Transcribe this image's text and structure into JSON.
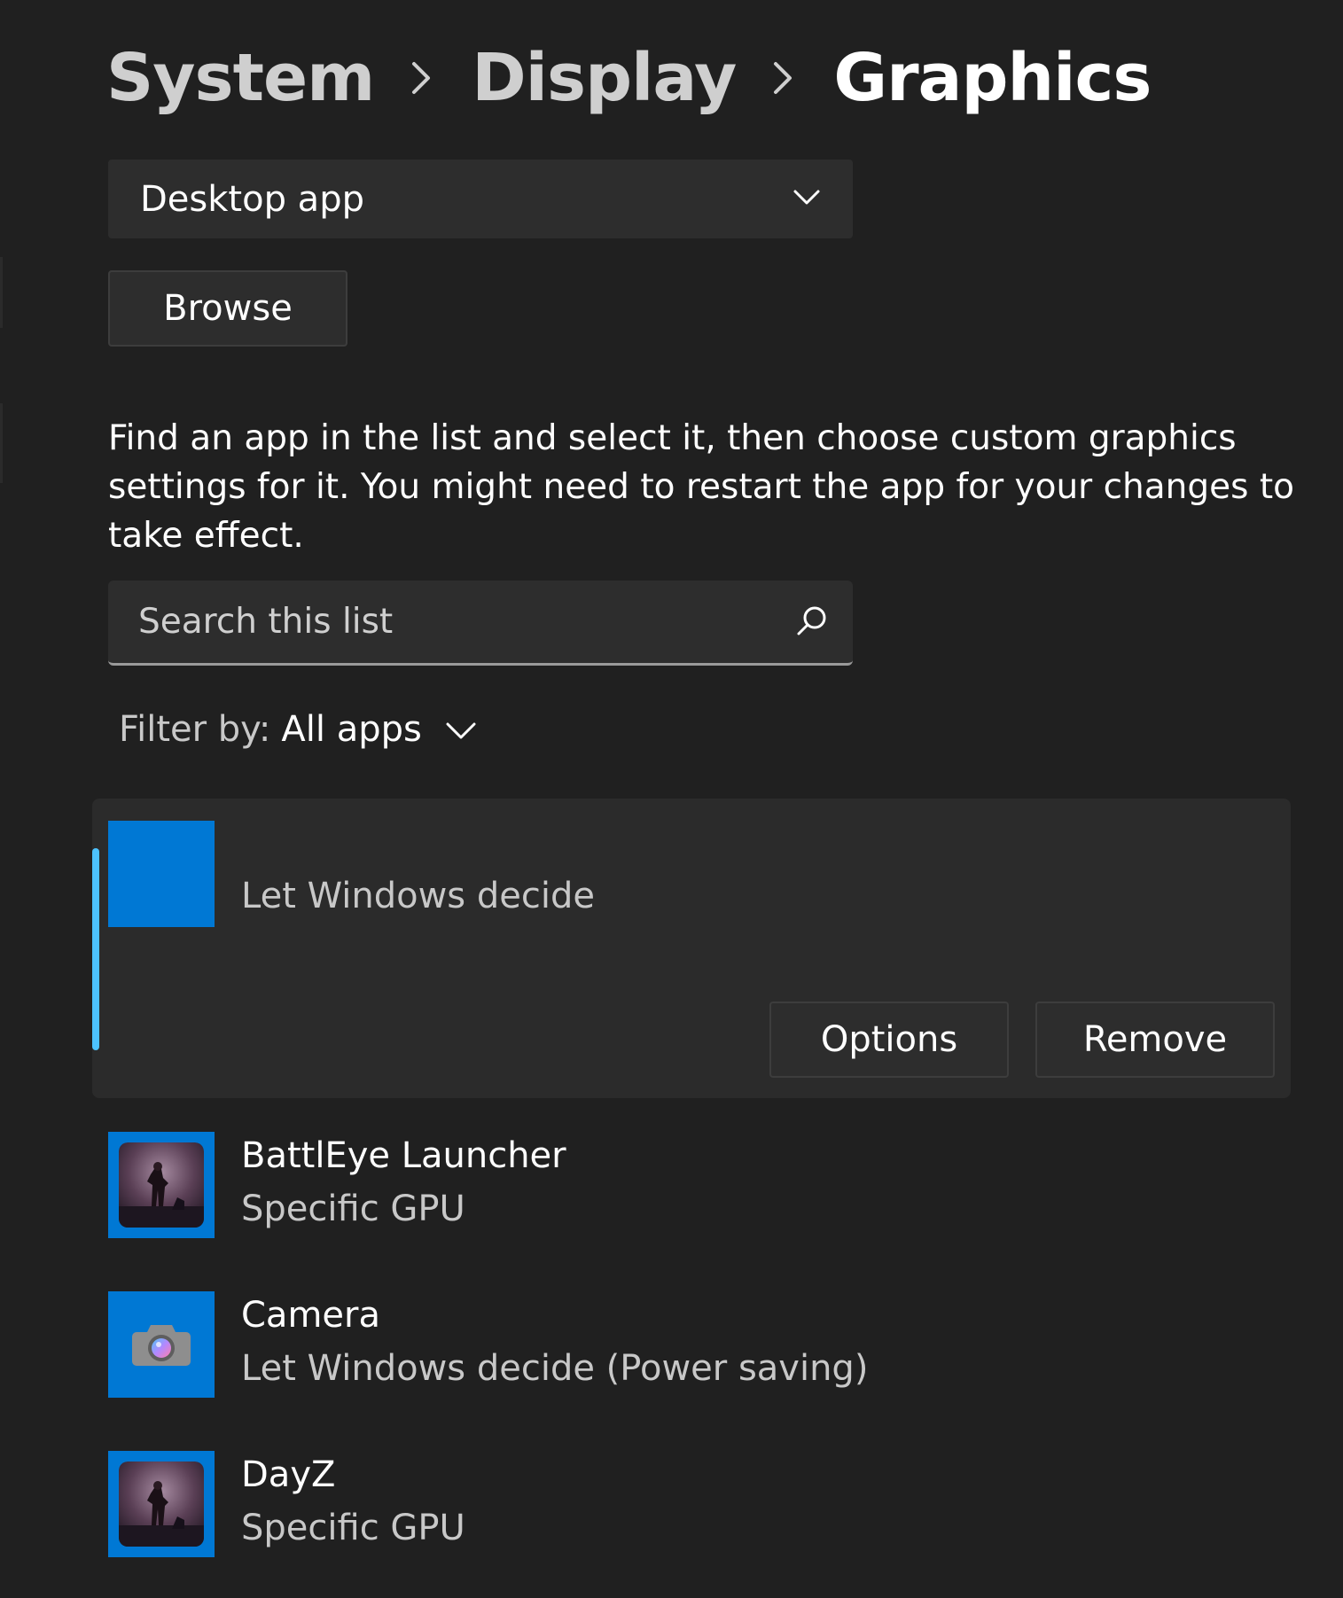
{
  "breadcrumb": {
    "items": [
      "System",
      "Display",
      "Graphics"
    ]
  },
  "app_type_select": {
    "value": "Desktop app",
    "icon": "chevron-down-icon"
  },
  "browse": {
    "label": "Browse"
  },
  "description": "Find an app in the list and select it, then choose custom graphics settings for it. You might need to restart the app for your changes to take effect.",
  "search": {
    "placeholder": "Search this list",
    "value": "",
    "icon": "search-icon"
  },
  "filter": {
    "label": "Filter by:",
    "value": "All apps",
    "icon": "chevron-down-icon"
  },
  "selected_app": {
    "status": "Let Windows decide",
    "options_label": "Options",
    "remove_label": "Remove"
  },
  "apps": [
    {
      "name": "BattlEye Launcher",
      "status": "Specific GPU",
      "icon": "game-icon"
    },
    {
      "name": "Camera",
      "status": "Let Windows decide (Power saving)",
      "icon": "camera-icon"
    },
    {
      "name": "DayZ",
      "status": "Specific GPU",
      "icon": "game-icon"
    }
  ],
  "colors": {
    "background": "#202020",
    "card": "#2b2b2b",
    "control": "#2d2d2d",
    "accent": "#0078d4",
    "selection_indicator": "#4cc2ff"
  }
}
